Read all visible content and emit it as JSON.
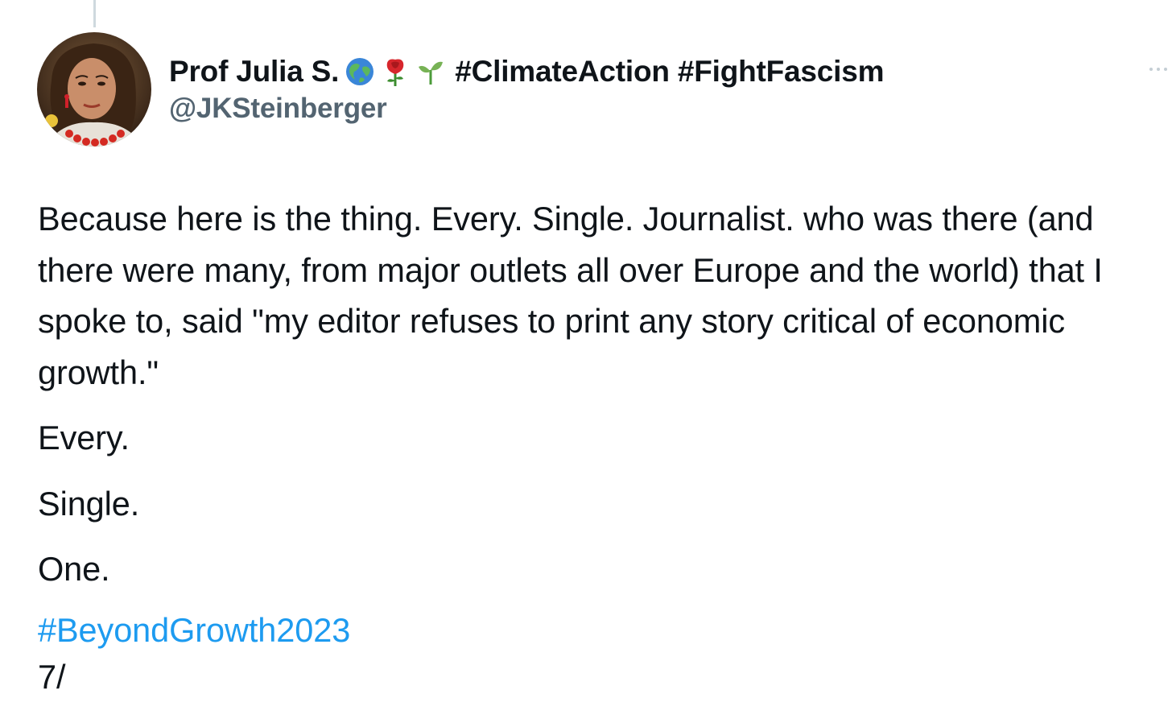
{
  "author": {
    "name": "Prof Julia S.",
    "handle": "@JKSteinberger",
    "bio_hashtags": "#ClimateAction #FightFascism",
    "emojis": [
      "globe-emoji",
      "rose-emoji",
      "seedling-emoji"
    ]
  },
  "tweet": {
    "paragraph": "Because here is the thing. Every. Single. Journalist. who was there (and there were many, from major outlets all over Europe and the world) that I spoke to, said \"my editor refuses to print any story critical of economic growth.\"",
    "line_every": "Every.",
    "line_single": "Single.",
    "line_one": "One.",
    "hashtag": "#BeyondGrowth2023",
    "thread_marker": "7/"
  },
  "colors": {
    "link": "#1d9bf0",
    "secondary_text": "#536471",
    "primary_text": "#0f1419"
  }
}
